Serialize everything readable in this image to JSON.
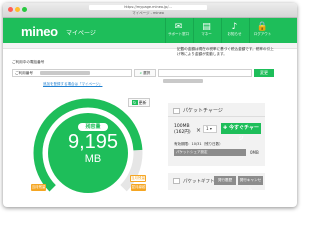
{
  "browser": {
    "url": "https://mypage.mineo.jp/...",
    "page_title": "マイページ - mineo"
  },
  "header": {
    "logo": "mineo",
    "subtitle": "マイページ",
    "nav": [
      {
        "icon": "support-icon",
        "glyph": "✉",
        "label": "サポート窓口"
      },
      {
        "icon": "chart-icon",
        "glyph": "▤",
        "label": "マネー"
      },
      {
        "icon": "bell-icon",
        "glyph": "♪",
        "label": "お知らせ"
      },
      {
        "icon": "lock-icon",
        "glyph": "🔒",
        "label": "ログアウト"
      }
    ]
  },
  "notice": "記載の金額は現在の税率に基づく税込金額です。税率の引上げ等により金額が変動します。",
  "account": {
    "section_label": "ご利用中の電話番号",
    "number_label": "ご利用番号",
    "select_button": "選択",
    "change_button": "変更",
    "register_link": "追加を登録する場合は「マイページ」"
  },
  "usage": {
    "update_button": "更新",
    "remain_label": "残容量",
    "remain_value": "9,195",
    "remain_unit": "MB",
    "fill_fraction": 0.82,
    "tag_left": "当月残量",
    "tag_right": "翌月繰越",
    "tag_right2": "当月残量"
  },
  "charge": {
    "title": "パケットチャージ",
    "plan_line1": "100MB",
    "plan_line2": "(162円)",
    "times": "×",
    "qty": "1",
    "buy_button": "今すぐチャージ",
    "valid_text": "有効期限：10/31（残り日数）",
    "slider_text": "パケットシェア設定",
    "slider_unit": "0MB"
  },
  "gift": {
    "title": "パケットギフト",
    "btn1": "発行履歴",
    "btn2": "発行キャンセル"
  },
  "colors": {
    "brand": "#1ebe5a",
    "accent": "#f5a623"
  }
}
